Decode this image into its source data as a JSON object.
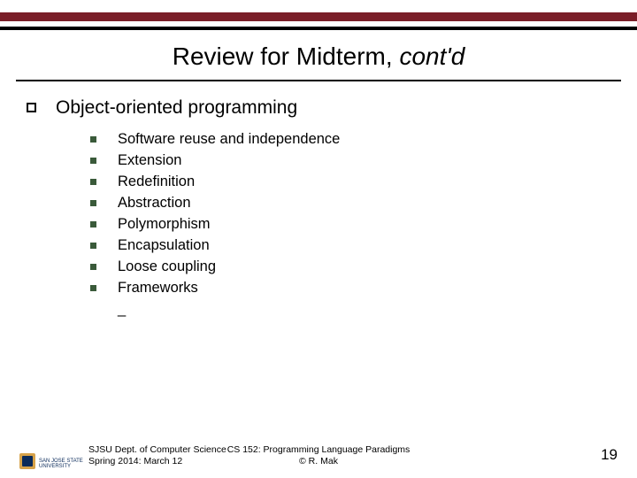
{
  "title": {
    "main": "Review for Midterm, ",
    "italic": "cont'd"
  },
  "section": "Object-oriented programming",
  "items": [
    "Software reuse and independence",
    "Extension",
    "Redefinition",
    "Abstraction",
    "Polymorphism",
    "Encapsulation",
    "Loose coupling",
    "Frameworks"
  ],
  "trailing_mark": "_",
  "footer": {
    "left_line1": "SJSU Dept. of Computer Science",
    "left_line2": "Spring 2014: March 12",
    "center_line1": "CS 152: Programming Language Paradigms",
    "center_line2": "© R. Mak",
    "page": "19",
    "logo_top": "SAN JOSE STATE",
    "logo_bottom": "UNIVERSITY"
  }
}
